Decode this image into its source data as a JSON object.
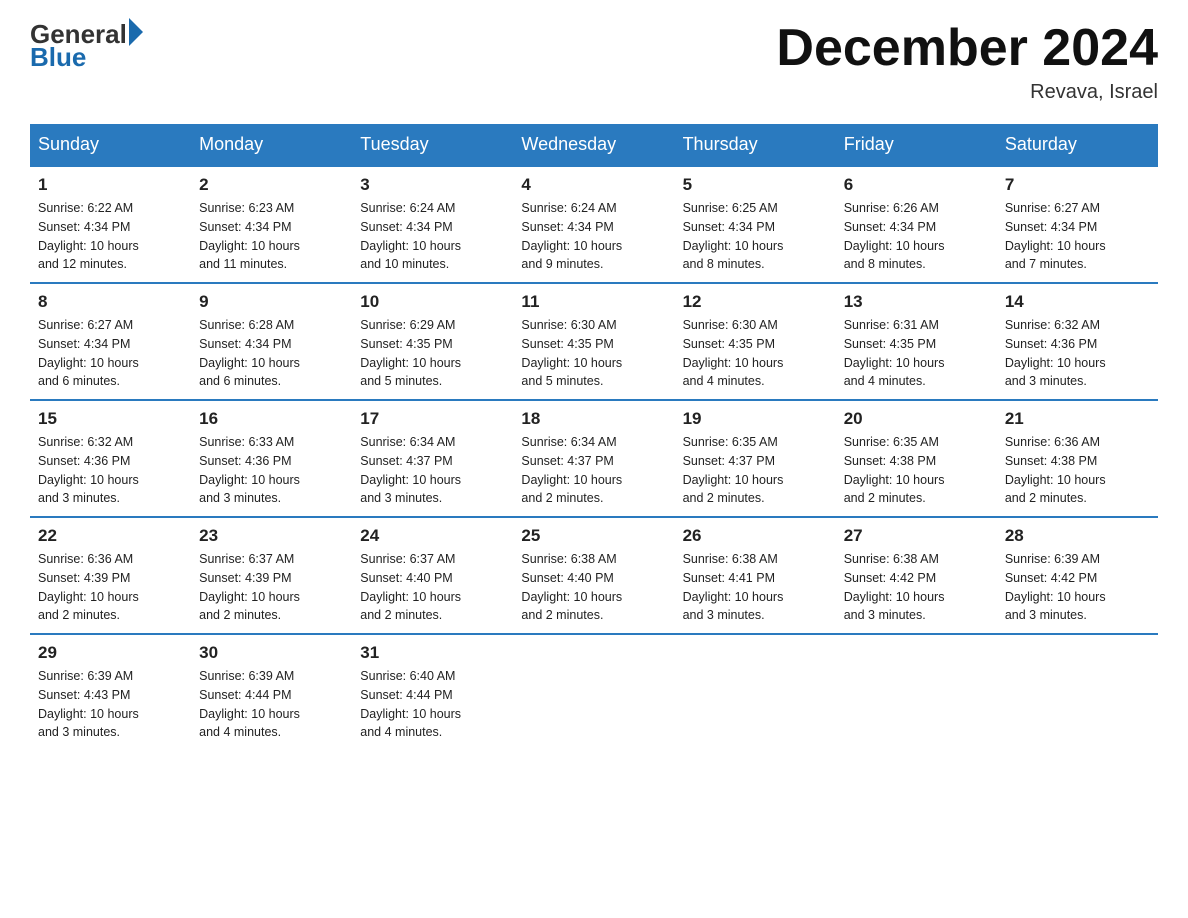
{
  "logo": {
    "general": "General",
    "blue": "Blue"
  },
  "title": "December 2024",
  "location": "Revava, Israel",
  "weekdays": [
    "Sunday",
    "Monday",
    "Tuesday",
    "Wednesday",
    "Thursday",
    "Friday",
    "Saturday"
  ],
  "weeks": [
    [
      {
        "day": "1",
        "info": "Sunrise: 6:22 AM\nSunset: 4:34 PM\nDaylight: 10 hours\nand 12 minutes."
      },
      {
        "day": "2",
        "info": "Sunrise: 6:23 AM\nSunset: 4:34 PM\nDaylight: 10 hours\nand 11 minutes."
      },
      {
        "day": "3",
        "info": "Sunrise: 6:24 AM\nSunset: 4:34 PM\nDaylight: 10 hours\nand 10 minutes."
      },
      {
        "day": "4",
        "info": "Sunrise: 6:24 AM\nSunset: 4:34 PM\nDaylight: 10 hours\nand 9 minutes."
      },
      {
        "day": "5",
        "info": "Sunrise: 6:25 AM\nSunset: 4:34 PM\nDaylight: 10 hours\nand 8 minutes."
      },
      {
        "day": "6",
        "info": "Sunrise: 6:26 AM\nSunset: 4:34 PM\nDaylight: 10 hours\nand 8 minutes."
      },
      {
        "day": "7",
        "info": "Sunrise: 6:27 AM\nSunset: 4:34 PM\nDaylight: 10 hours\nand 7 minutes."
      }
    ],
    [
      {
        "day": "8",
        "info": "Sunrise: 6:27 AM\nSunset: 4:34 PM\nDaylight: 10 hours\nand 6 minutes."
      },
      {
        "day": "9",
        "info": "Sunrise: 6:28 AM\nSunset: 4:34 PM\nDaylight: 10 hours\nand 6 minutes."
      },
      {
        "day": "10",
        "info": "Sunrise: 6:29 AM\nSunset: 4:35 PM\nDaylight: 10 hours\nand 5 minutes."
      },
      {
        "day": "11",
        "info": "Sunrise: 6:30 AM\nSunset: 4:35 PM\nDaylight: 10 hours\nand 5 minutes."
      },
      {
        "day": "12",
        "info": "Sunrise: 6:30 AM\nSunset: 4:35 PM\nDaylight: 10 hours\nand 4 minutes."
      },
      {
        "day": "13",
        "info": "Sunrise: 6:31 AM\nSunset: 4:35 PM\nDaylight: 10 hours\nand 4 minutes."
      },
      {
        "day": "14",
        "info": "Sunrise: 6:32 AM\nSunset: 4:36 PM\nDaylight: 10 hours\nand 3 minutes."
      }
    ],
    [
      {
        "day": "15",
        "info": "Sunrise: 6:32 AM\nSunset: 4:36 PM\nDaylight: 10 hours\nand 3 minutes."
      },
      {
        "day": "16",
        "info": "Sunrise: 6:33 AM\nSunset: 4:36 PM\nDaylight: 10 hours\nand 3 minutes."
      },
      {
        "day": "17",
        "info": "Sunrise: 6:34 AM\nSunset: 4:37 PM\nDaylight: 10 hours\nand 3 minutes."
      },
      {
        "day": "18",
        "info": "Sunrise: 6:34 AM\nSunset: 4:37 PM\nDaylight: 10 hours\nand 2 minutes."
      },
      {
        "day": "19",
        "info": "Sunrise: 6:35 AM\nSunset: 4:37 PM\nDaylight: 10 hours\nand 2 minutes."
      },
      {
        "day": "20",
        "info": "Sunrise: 6:35 AM\nSunset: 4:38 PM\nDaylight: 10 hours\nand 2 minutes."
      },
      {
        "day": "21",
        "info": "Sunrise: 6:36 AM\nSunset: 4:38 PM\nDaylight: 10 hours\nand 2 minutes."
      }
    ],
    [
      {
        "day": "22",
        "info": "Sunrise: 6:36 AM\nSunset: 4:39 PM\nDaylight: 10 hours\nand 2 minutes."
      },
      {
        "day": "23",
        "info": "Sunrise: 6:37 AM\nSunset: 4:39 PM\nDaylight: 10 hours\nand 2 minutes."
      },
      {
        "day": "24",
        "info": "Sunrise: 6:37 AM\nSunset: 4:40 PM\nDaylight: 10 hours\nand 2 minutes."
      },
      {
        "day": "25",
        "info": "Sunrise: 6:38 AM\nSunset: 4:40 PM\nDaylight: 10 hours\nand 2 minutes."
      },
      {
        "day": "26",
        "info": "Sunrise: 6:38 AM\nSunset: 4:41 PM\nDaylight: 10 hours\nand 3 minutes."
      },
      {
        "day": "27",
        "info": "Sunrise: 6:38 AM\nSunset: 4:42 PM\nDaylight: 10 hours\nand 3 minutes."
      },
      {
        "day": "28",
        "info": "Sunrise: 6:39 AM\nSunset: 4:42 PM\nDaylight: 10 hours\nand 3 minutes."
      }
    ],
    [
      {
        "day": "29",
        "info": "Sunrise: 6:39 AM\nSunset: 4:43 PM\nDaylight: 10 hours\nand 3 minutes."
      },
      {
        "day": "30",
        "info": "Sunrise: 6:39 AM\nSunset: 4:44 PM\nDaylight: 10 hours\nand 4 minutes."
      },
      {
        "day": "31",
        "info": "Sunrise: 6:40 AM\nSunset: 4:44 PM\nDaylight: 10 hours\nand 4 minutes."
      },
      null,
      null,
      null,
      null
    ]
  ]
}
